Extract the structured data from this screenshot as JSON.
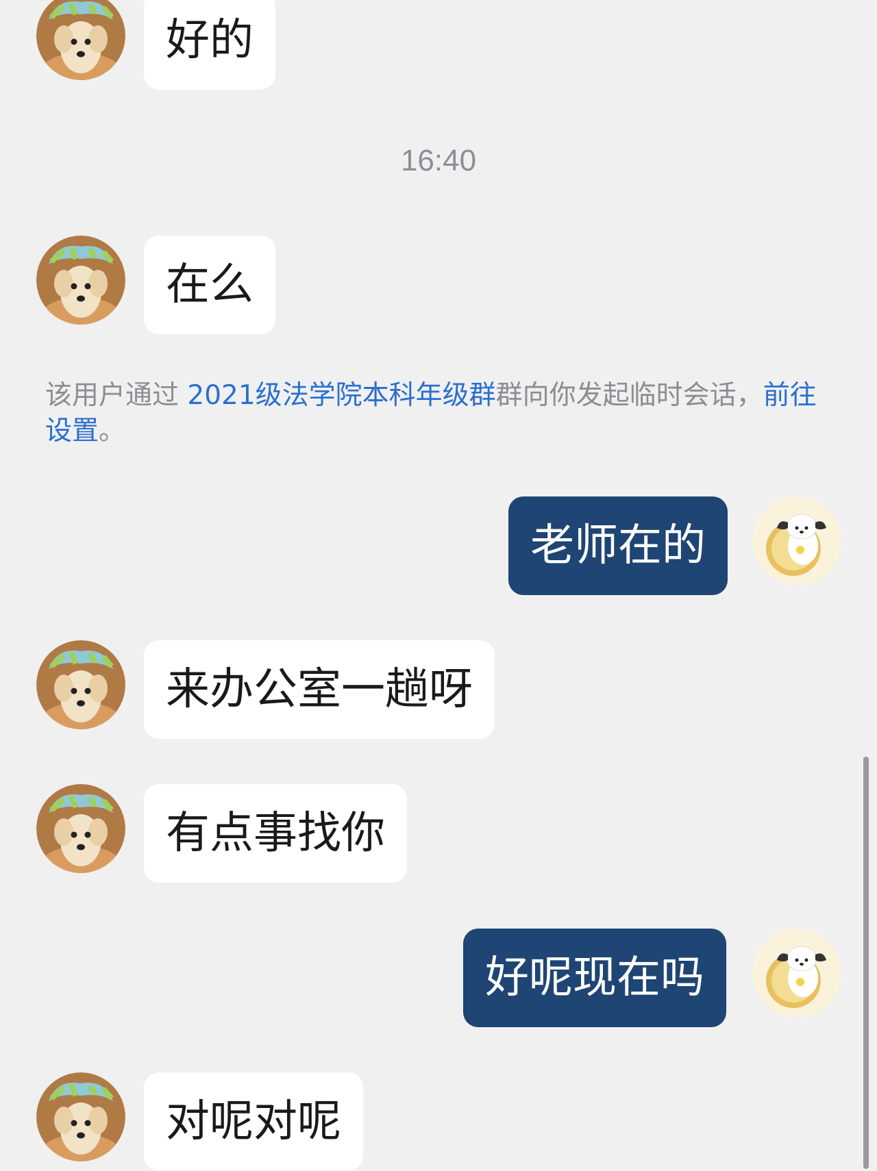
{
  "messages": [
    {
      "side": "left",
      "text": "好的"
    },
    {
      "side": "left",
      "text": "在么"
    },
    {
      "side": "right",
      "text": "老师在的"
    },
    {
      "side": "left",
      "text": "来办公室一趟呀"
    },
    {
      "side": "left",
      "text": "有点事找你"
    },
    {
      "side": "right",
      "text": "好呢现在吗"
    },
    {
      "side": "left",
      "text": "对呢对呢"
    }
  ],
  "timestamp": "16:40",
  "notice": {
    "prefix": "该用户通过 ",
    "group_name": "2021级法学院本科年级群",
    "middle": "群向你发起临时会话，",
    "link": "前往设置",
    "suffix": "。"
  },
  "colors": {
    "background": "#f0f0f0",
    "incoming_bubble": "#ffffff",
    "outgoing_bubble": "#1e4573",
    "link": "#2b6fcf"
  },
  "icons": {
    "incoming_avatar": "dog-avatar-icon",
    "outgoing_avatar": "pochacco-avatar-icon"
  }
}
